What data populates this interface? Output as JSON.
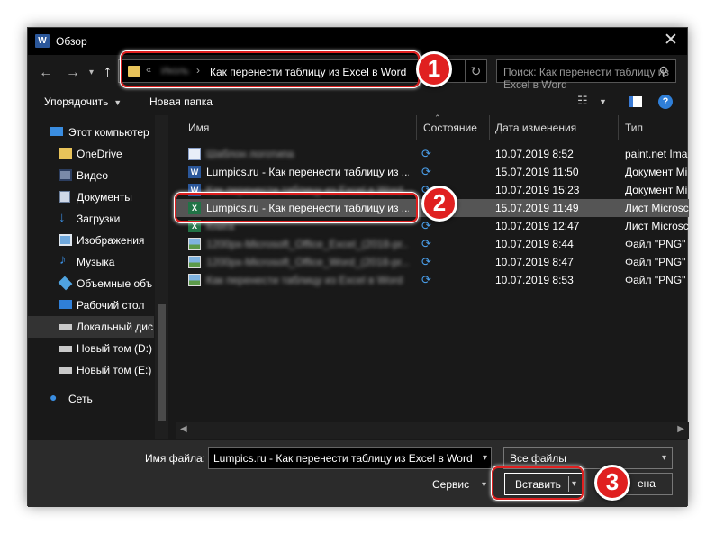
{
  "window": {
    "title": "Обзор",
    "app_badge": "W"
  },
  "address": {
    "crumb_sep_left": "«",
    "crumb_hidden": "Иколь",
    "crumb_sep": "›",
    "current": "Как перенести таблицу из Excel в Word"
  },
  "search": {
    "placeholder": "Поиск: Как перенести таблицу из Excel в Word"
  },
  "toolbar": {
    "organize": "Упорядочить",
    "new_folder": "Новая папка"
  },
  "sidebar": {
    "items": [
      {
        "label": "Этот компьютер",
        "icon": "computer-icon"
      },
      {
        "label": "OneDrive",
        "icon": "folder-icon"
      },
      {
        "label": "Видео",
        "icon": "video-icon"
      },
      {
        "label": "Документы",
        "icon": "documents-icon"
      },
      {
        "label": "Загрузки",
        "icon": "download-icon"
      },
      {
        "label": "Изображения",
        "icon": "pictures-icon"
      },
      {
        "label": "Музыка",
        "icon": "music-icon"
      },
      {
        "label": "Объемные объ",
        "icon": "3d-objects-icon"
      },
      {
        "label": "Рабочий стол",
        "icon": "desktop-icon"
      },
      {
        "label": "Локальный дис",
        "icon": "drive-icon",
        "selected": true
      },
      {
        "label": "Новый том (D:)",
        "icon": "drive-icon"
      },
      {
        "label": "Новый том (E:)",
        "icon": "drive-icon"
      },
      {
        "label": "Сеть",
        "icon": "network-icon"
      }
    ]
  },
  "columns": {
    "name": "Имя",
    "status": "Состояние",
    "date": "Дата изменения",
    "type": "Тип"
  },
  "files": [
    {
      "name": "Шаблон логотипа",
      "blur": true,
      "icon": "paintnet-icon",
      "date": "10.07.2019 8:52",
      "type": "paint.net Ima"
    },
    {
      "name": "Lumpics.ru - Как перенести таблицу из ...",
      "blur": false,
      "icon": "word-doc-icon",
      "date": "15.07.2019 11:50",
      "type": "Документ Mi"
    },
    {
      "name": "Как перенести таблицу из Excel в Word",
      "blur": true,
      "icon": "word-doc-icon",
      "date": "10.07.2019 15:23",
      "type": "Документ Mi"
    },
    {
      "name": "Lumpics.ru - Как перенести таблицу из ...",
      "blur": false,
      "icon": "excel-icon",
      "date": "15.07.2019 11:49",
      "type": "Лист Microsc",
      "selected": true
    },
    {
      "name": "Книга",
      "blur": true,
      "icon": "excel-icon",
      "date": "10.07.2019 12:47",
      "type": "Лист Microsc"
    },
    {
      "name": "1200px-Microsoft_Office_Excel_(2018-pr...",
      "blur": true,
      "icon": "image-icon",
      "date": "10.07.2019 8:44",
      "type": "Файл \"PNG\""
    },
    {
      "name": "1200px-Microsoft_Office_Word_(2018-pr...",
      "blur": true,
      "icon": "image-icon",
      "date": "10.07.2019 8:47",
      "type": "Файл \"PNG\""
    },
    {
      "name": "Как перенести таблицу из Excel в Word",
      "blur": true,
      "icon": "image-icon",
      "date": "10.07.2019 8:53",
      "type": "Файл \"PNG\""
    }
  ],
  "bottom": {
    "filename_label": "Имя файла:",
    "filename_value": "Lumpics.ru - Как перенести таблицу из Excel в Word",
    "filter_value": "Все файлы",
    "service": "Сервис",
    "insert": "Вставить",
    "cancel": "Отмена",
    "cancel_visible": "ена"
  },
  "callouts": [
    "1",
    "2",
    "3"
  ],
  "colors": {
    "accent_red": "#e02020",
    "sync_blue": "#4a9eea",
    "bg": "#191919"
  }
}
